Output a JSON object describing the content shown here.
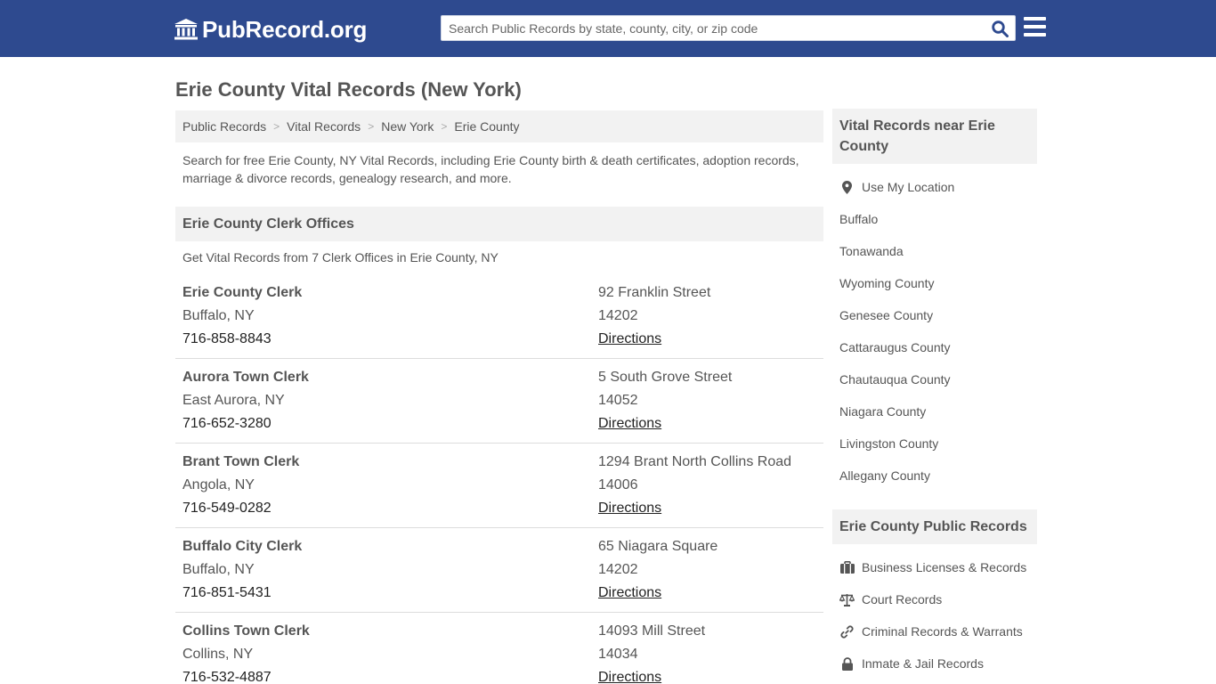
{
  "header": {
    "logo_text": "PubRecord.org",
    "search_placeholder": "Search Public Records by state, county, city, or zip code",
    "bg_color": "#2e4a8f"
  },
  "page": {
    "title": "Erie County Vital Records (New York)",
    "breadcrumb": [
      "Public Records",
      "Vital Records",
      "New York",
      "Erie County"
    ],
    "intro": "Search for free Erie County, NY Vital Records, including Erie County birth & death certificates, adoption records, marriage & divorce records, genealogy research, and more."
  },
  "offices_section": {
    "title": "Erie County Clerk Offices",
    "subtitle": "Get Vital Records from 7 Clerk Offices in Erie County, NY",
    "directions_label": "Directions",
    "offices": [
      {
        "name": "Erie County Clerk",
        "city": "Buffalo, NY",
        "phone": "716-858-8843",
        "street": "92 Franklin Street",
        "zip": "14202"
      },
      {
        "name": "Aurora Town Clerk",
        "city": "East Aurora, NY",
        "phone": "716-652-3280",
        "street": "5 South Grove Street",
        "zip": "14052"
      },
      {
        "name": "Brant Town Clerk",
        "city": "Angola, NY",
        "phone": "716-549-0282",
        "street": "1294 Brant North Collins Road",
        "zip": "14006"
      },
      {
        "name": "Buffalo City Clerk",
        "city": "Buffalo, NY",
        "phone": "716-851-5431",
        "street": "65 Niagara Square",
        "zip": "14202"
      },
      {
        "name": "Collins Town Clerk",
        "city": "Collins, NY",
        "phone": "716-532-4887",
        "street": "14093 Mill Street",
        "zip": "14034"
      }
    ]
  },
  "sidebar": {
    "nearby_title": "Vital Records near Erie County",
    "use_location": "Use My Location",
    "nearby": [
      "Buffalo",
      "Tonawanda",
      "Wyoming County",
      "Genesee County",
      "Cattaraugus County",
      "Chautauqua County",
      "Niagara County",
      "Livingston County",
      "Allegany County"
    ],
    "public_title": "Erie County Public Records",
    "public_records": [
      {
        "label": "Business Licenses & Records",
        "icon": "briefcase-icon"
      },
      {
        "label": "Court Records",
        "icon": "scales-icon"
      },
      {
        "label": "Criminal Records & Warrants",
        "icon": "link-icon"
      },
      {
        "label": "Inmate & Jail Records",
        "icon": "lock-icon"
      }
    ]
  }
}
